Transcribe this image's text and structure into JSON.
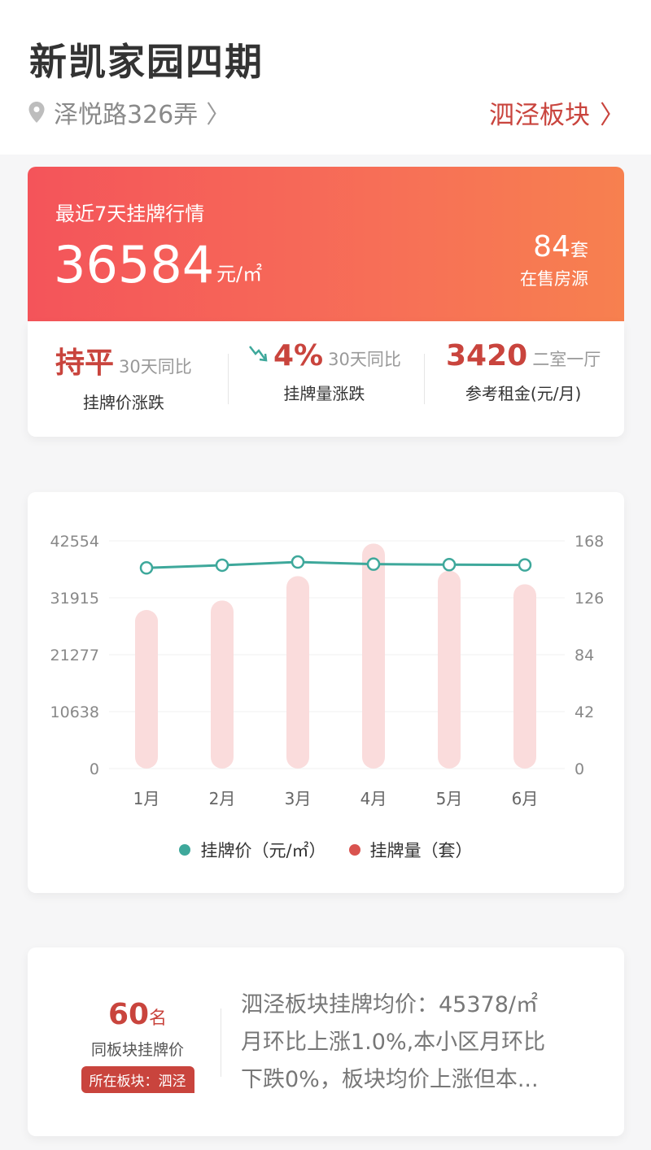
{
  "header": {
    "title": "新凯家园四期",
    "address": "泽悦路326弄",
    "district": "泗泾板块"
  },
  "hero": {
    "label": "最近7天挂牌行情",
    "price": "36584",
    "price_unit": "元/㎡",
    "count": "84",
    "count_unit": "套",
    "count_label": "在售房源"
  },
  "stats": [
    {
      "big": "持平",
      "small": "30天同比",
      "sub": "挂牌价涨跌"
    },
    {
      "big": "4%",
      "small": "30天同比",
      "sub": "挂牌量涨跌",
      "trend": "down"
    },
    {
      "big": "3420",
      "small": "二室一厅",
      "sub": "参考租金(元/月)"
    }
  ],
  "chart_data": {
    "type": "bar",
    "categories": [
      "1月",
      "2月",
      "3月",
      "4月",
      "5月",
      "6月"
    ],
    "series": [
      {
        "name": "挂牌价（元/㎡）",
        "kind": "line",
        "axis": "left",
        "color": "#3ea89b",
        "values": [
          37500,
          38000,
          38600,
          38200,
          38100,
          38050
        ]
      },
      {
        "name": "挂牌量（套）",
        "kind": "bar",
        "axis": "right",
        "color": "#fadcdc",
        "values": [
          117,
          124,
          142,
          166,
          146,
          136
        ]
      }
    ],
    "ylim_left": [
      0,
      42554
    ],
    "yticks_left": [
      "0",
      "10638",
      "21277",
      "31915",
      "42554"
    ],
    "ylim_right": [
      0,
      168
    ],
    "yticks_right": [
      "0",
      "42",
      "84",
      "126",
      "168"
    ],
    "grid": true,
    "legend": "bottom"
  },
  "legend": [
    {
      "label": "挂牌价（元/㎡）",
      "color": "#3ea89b"
    },
    {
      "label": "挂牌量（套）",
      "color": "#d9534f"
    }
  ],
  "rank": {
    "number": "60",
    "suffix": "名",
    "label": "同板块挂牌价",
    "badge": "所在板块：泗泾",
    "lines": [
      "泗泾板块挂牌均价：45378/㎡",
      "月环比上涨1.0%,本小区月环比",
      "下跌0%，板块均价上涨但本..."
    ]
  }
}
